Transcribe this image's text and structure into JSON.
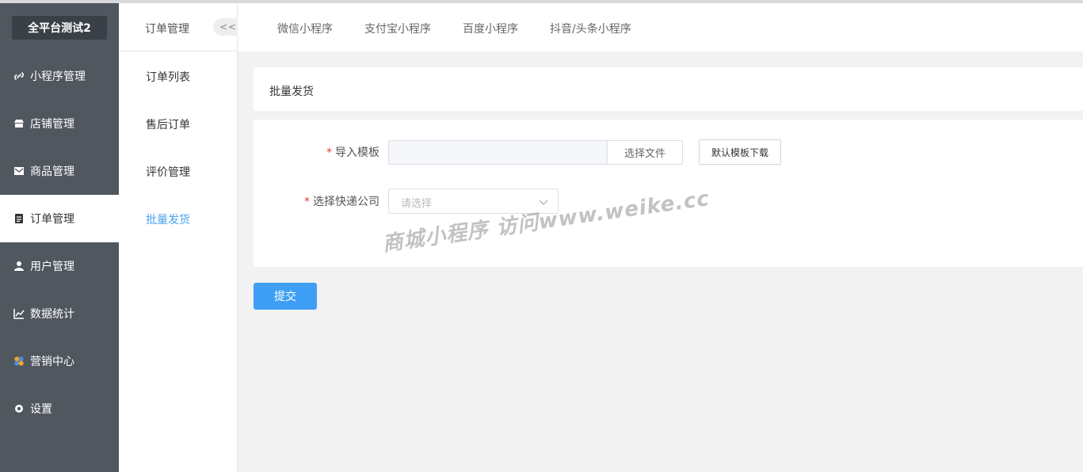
{
  "brand": "全平台测试2",
  "sidebar": {
    "items": [
      {
        "label": "小程序管理",
        "icon": "link-icon"
      },
      {
        "label": "店铺管理",
        "icon": "store-icon"
      },
      {
        "label": "商品管理",
        "icon": "mail-icon"
      },
      {
        "label": "订单管理",
        "icon": "clipboard-icon"
      },
      {
        "label": "用户管理",
        "icon": "user-icon"
      },
      {
        "label": "数据统计",
        "icon": "chart-icon"
      },
      {
        "label": "营销中心",
        "icon": "marketing-icon"
      },
      {
        "label": "设置",
        "icon": "gear-icon"
      }
    ]
  },
  "subbar": {
    "title": "订单管理",
    "collapse": "<<",
    "items": [
      "订单列表",
      "售后订单",
      "评价管理",
      "批量发货"
    ]
  },
  "tabs": [
    "微信小程序",
    "支付宝小程序",
    "百度小程序",
    "抖音/头条小程序"
  ],
  "page": {
    "title": "批量发货"
  },
  "form": {
    "required_mark": "*",
    "import_label": "导入模板",
    "file_button": "选择文件",
    "template_button": "默认模板下载",
    "express_label": "选择快递公司",
    "express_placeholder": "请选择"
  },
  "submit": "提交",
  "watermark": "商城小程序 访问www.weike.cc",
  "colors": {
    "sidebar": "#50575f",
    "accent": "#3e9ff5",
    "active_sub": "#4aa1f0",
    "required": "#e4393c"
  }
}
